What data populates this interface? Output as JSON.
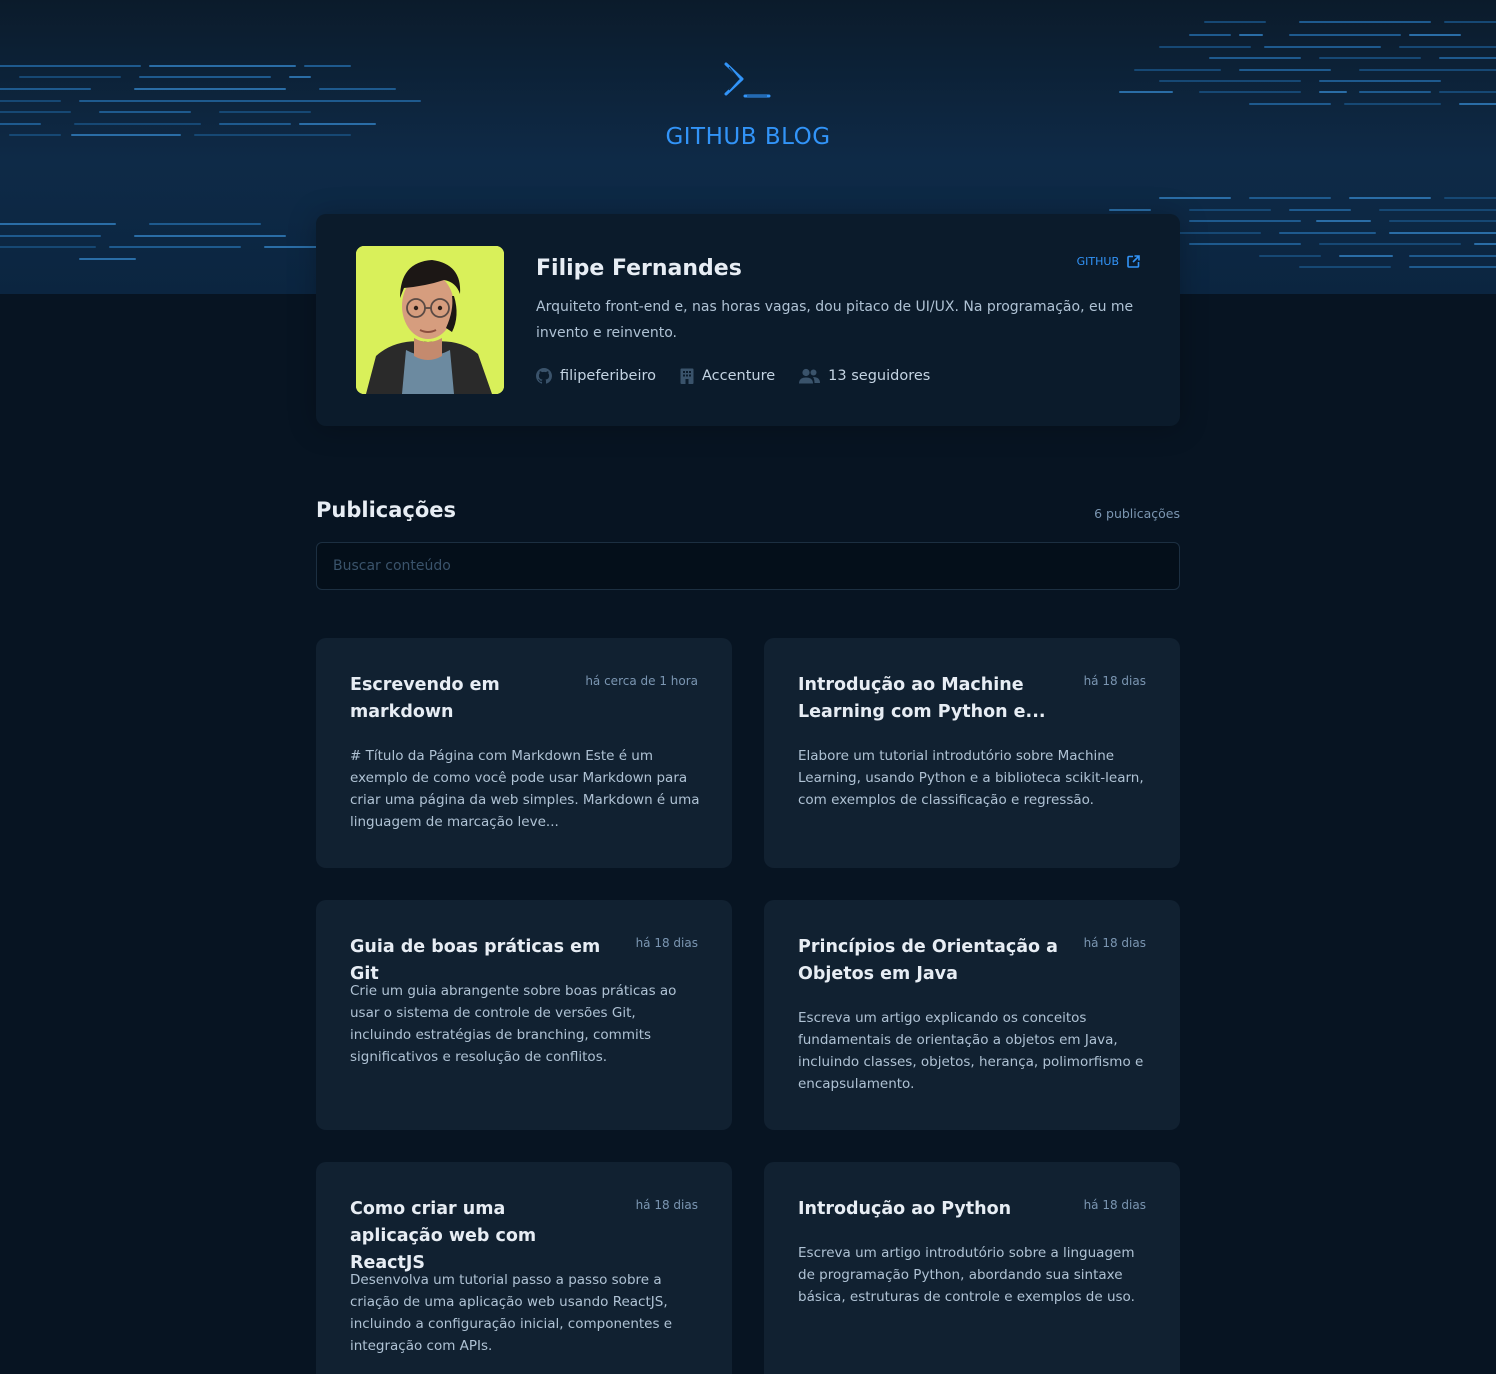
{
  "brand": {
    "title": "GITHUB BLOG",
    "icon": "terminal-prompt-icon",
    "accent": "#3294F8"
  },
  "profile": {
    "name": "Filipe Fernandes",
    "github_label": "GITHUB",
    "bio": "Arquiteto front-end e, nas horas vagas, dou pitaco de UI/UX. Na programação, eu me invento e reinvento.",
    "username": "filipeferibeiro",
    "company": "Accenture",
    "followers": "13 seguidores"
  },
  "publications": {
    "title": "Publicações",
    "count": "6 publicações",
    "search_placeholder": "Buscar conteúdo"
  },
  "posts": [
    {
      "title": "Escrevendo em markdown",
      "time": "há cerca de 1 hora",
      "excerpt": "# Título da Página com Markdown Este é um exemplo de como você pode usar Markdown para criar uma página da web simples. Markdown é uma linguagem de marcação leve..."
    },
    {
      "title": "Introdução ao Machine Learning com Python e...",
      "time": "há 18 dias",
      "excerpt": "Elabore um tutorial introdutório sobre Machine Learning, usando Python e a biblioteca scikit-learn, com exemplos de classificação e regressão."
    },
    {
      "title": "Guia de boas práticas em Git",
      "time": "há 18 dias",
      "excerpt": "Crie um guia abrangente sobre boas práticas ao usar o sistema de controle de versões Git, incluindo estratégias de branching, commits significativos e resolução de conflitos."
    },
    {
      "title": "Princípios de Orientação a Objetos em Java",
      "time": "há 18 dias",
      "excerpt": "Escreva um artigo explicando os conceitos fundamentais de orientação a objetos em Java, incluindo classes, objetos, herança, polimorfismo e encapsulamento."
    },
    {
      "title": "Como criar uma aplicação web com ReactJS",
      "time": "há 18 dias",
      "excerpt": "Desenvolva um tutorial passo a passo sobre a criação de uma aplicação web usando ReactJS, incluindo a configuração inicial, componentes e integração com APIs."
    },
    {
      "title": "Introdução ao Python",
      "time": "há 18 dias",
      "excerpt": "Escreva um artigo introdutório sobre a linguagem de programação Python, abordando sua sintaxe básica, estruturas de controle e exemplos de uso."
    }
  ]
}
